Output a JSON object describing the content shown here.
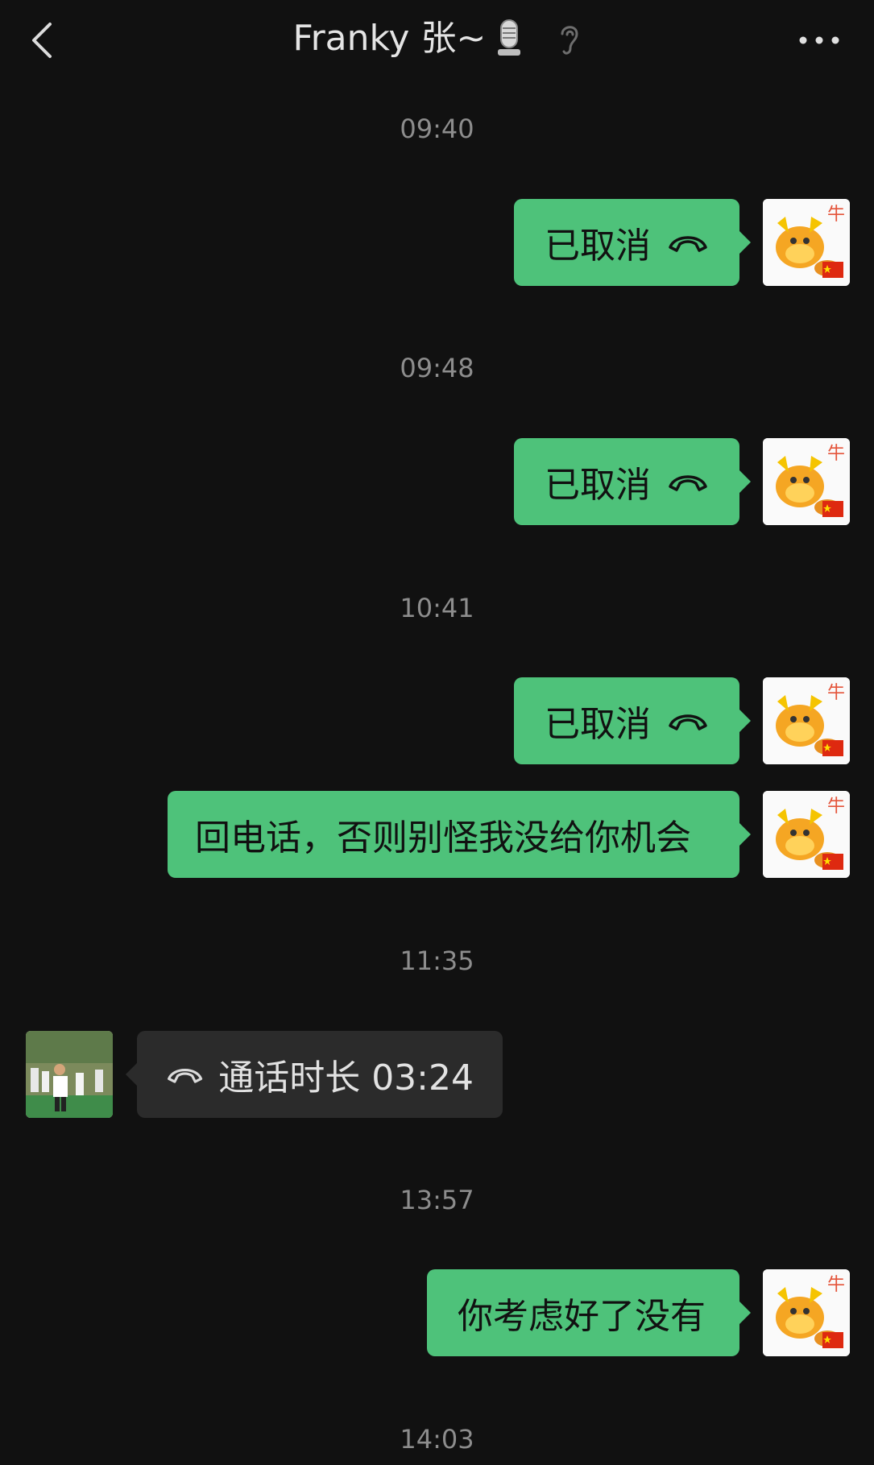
{
  "header": {
    "title": "Franky 张~"
  },
  "messages": [
    {
      "time": "09:40",
      "text": "已取消",
      "dir": "out",
      "call": true
    },
    {
      "time": "09:48",
      "text": "已取消",
      "dir": "out",
      "call": true
    },
    {
      "time": "10:41",
      "text": "已取消",
      "dir": "out",
      "call": true
    },
    {
      "text": "回电话，否则别怪我没给你机会",
      "dir": "out",
      "call": false
    },
    {
      "time": "11:35",
      "text": "通话时长 03:24",
      "dir": "in",
      "call": true
    },
    {
      "time": "13:57",
      "text": "你考虑好了没有",
      "dir": "out",
      "call": false
    },
    {
      "time": "14:03"
    }
  ],
  "colors": {
    "background": "#111111",
    "outgoing_bubble": "#4ec27a",
    "incoming_bubble": "#2b2b2b",
    "timestamp": "#8d8d8d"
  },
  "icons": [
    "back-arrow-icon",
    "microphone-icon",
    "ear-icon",
    "more-icon",
    "phone-hangup-icon",
    "bull-avatar",
    "contact-photo-avatar"
  ]
}
